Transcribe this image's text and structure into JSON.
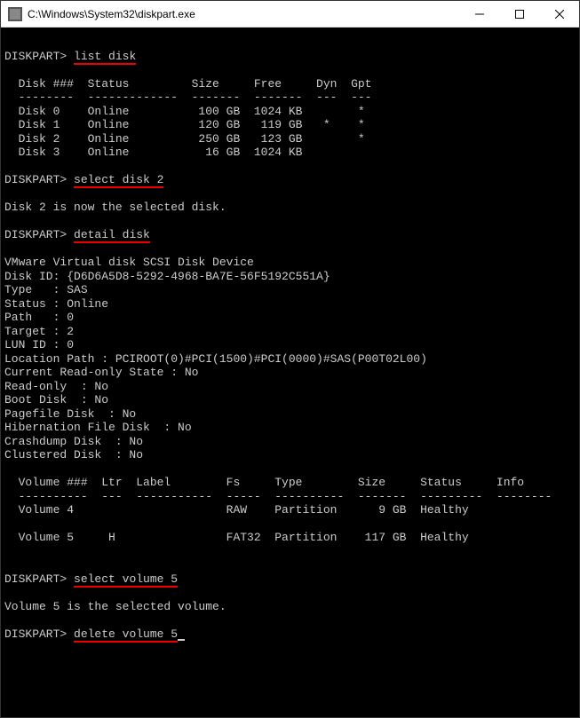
{
  "window": {
    "title": "C:\\Windows\\System32\\diskpart.exe"
  },
  "prompt": "DISKPART>",
  "commands": {
    "list_disk": "list disk",
    "select_disk": "select disk 2",
    "detail_disk": "detail disk",
    "select_volume": "select volume 5",
    "delete_volume": "delete volume 5"
  },
  "disk_table": {
    "header": "  Disk ###  Status         Size     Free     Dyn  Gpt",
    "divider": "  --------  -------------  -------  -------  ---  ---",
    "rows": [
      "  Disk 0    Online          100 GB  1024 KB        *",
      "  Disk 1    Online          120 GB   119 GB   *    *",
      "  Disk 2    Online          250 GB   123 GB        *",
      "  Disk 3    Online           16 GB  1024 KB"
    ]
  },
  "select_disk_msg": "Disk 2 is now the selected disk.",
  "detail": {
    "device": "VMware Virtual disk SCSI Disk Device",
    "disk_id": "Disk ID: {D6D6A5D8-5292-4968-BA7E-56F5192C551A}",
    "type": "Type   : SAS",
    "status": "Status : Online",
    "path": "Path   : 0",
    "target": "Target : 2",
    "lun_id": "LUN ID : 0",
    "location": "Location Path : PCIROOT(0)#PCI(1500)#PCI(0000)#SAS(P00T02L00)",
    "readonly_state": "Current Read-only State : No",
    "readonly": "Read-only  : No",
    "boot": "Boot Disk  : No",
    "pagefile": "Pagefile Disk  : No",
    "hibernation": "Hibernation File Disk  : No",
    "crashdump": "Crashdump Disk  : No",
    "clustered": "Clustered Disk  : No"
  },
  "volume_table": {
    "header": "  Volume ###  Ltr  Label        Fs     Type        Size     Status     Info",
    "divider": "  ----------  ---  -----------  -----  ----------  -------  ---------  --------",
    "rows": [
      "  Volume 4                      RAW    Partition      9 GB  Healthy",
      "  Volume 5     H                FAT32  Partition    117 GB  Healthy"
    ]
  },
  "select_volume_msg": "Volume 5 is the selected volume."
}
